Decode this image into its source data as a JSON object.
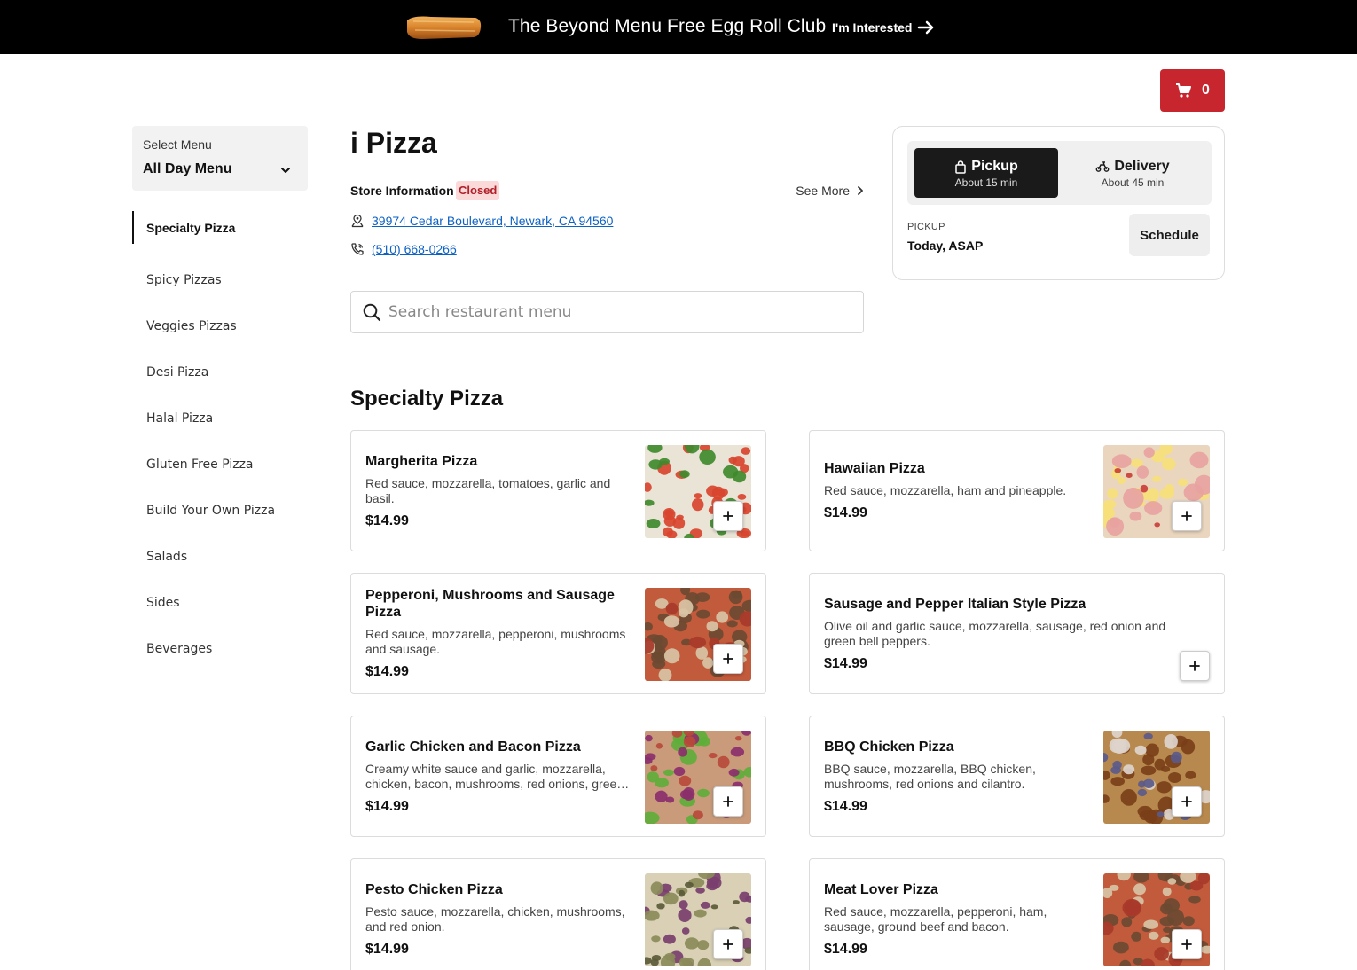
{
  "banner": {
    "title": "The Beyond Menu Free Egg Roll Club",
    "cta_label": "I'm Interested"
  },
  "cart": {
    "count": "0"
  },
  "menu_select": {
    "label": "Select Menu",
    "value": "All Day Menu"
  },
  "sidebar": {
    "items": [
      {
        "label": "Specialty Pizza",
        "active": true
      },
      {
        "label": "Spicy Pizzas"
      },
      {
        "label": "Veggies Pizzas"
      },
      {
        "label": "Desi Pizza"
      },
      {
        "label": "Halal Pizza"
      },
      {
        "label": "Gluten Free Pizza"
      },
      {
        "label": "Build Your Own Pizza"
      },
      {
        "label": "Salads"
      },
      {
        "label": "Sides"
      },
      {
        "label": "Beverages"
      }
    ]
  },
  "store": {
    "name": "i Pizza",
    "info_label": "Store Information",
    "status": "Closed",
    "see_more": "See More",
    "address": "39974 Cedar Boulevard, Newark, CA 94560",
    "phone": "(510) 668-0266"
  },
  "search": {
    "placeholder": "Search restaurant menu"
  },
  "order": {
    "pickup": {
      "label": "Pickup",
      "time": "About 15 min"
    },
    "delivery": {
      "label": "Delivery",
      "time": "About 45 min"
    },
    "mode_caption": "PICKUP",
    "when": "Today, ASAP",
    "schedule_label": "Schedule"
  },
  "section": {
    "title": "Specialty Pizza",
    "items": [
      {
        "name": "Margherita Pizza",
        "desc": "Red sauce, mozzarella, tomatoes, garlic and basil.",
        "price": "$14.99",
        "image": "margherita"
      },
      {
        "name": "Hawaiian Pizza",
        "desc": "Red sauce, mozzarella, ham and pineapple.",
        "price": "$14.99",
        "image": "hawaiian"
      },
      {
        "name": "Pepperoni, Mushrooms and Sausage Pizza",
        "desc": "Red sauce, mozzarella, pepperoni, mushrooms and sausage.",
        "price": "$14.99",
        "image": "meat"
      },
      {
        "name": "Sausage and Pepper Italian Style Pizza",
        "desc": "Olive oil and garlic sauce, mozzarella, sausage, red onion and green bell peppers.",
        "price": "$14.99",
        "image": null
      },
      {
        "name": "Garlic Chicken and Bacon Pizza",
        "desc": "Creamy white sauce and garlic, mozzarella, chicken, bacon, mushrooms, red onions, green peppers.",
        "price": "$14.99",
        "image": "veggie"
      },
      {
        "name": "BBQ Chicken Pizza",
        "desc": "BBQ sauce, mozzarella, BBQ chicken, mushrooms, red onions and cilantro.",
        "price": "$14.99",
        "image": "bbq"
      },
      {
        "name": "Pesto Chicken Pizza",
        "desc": "Pesto sauce, mozzarella, chicken, mushrooms, and red onion.",
        "price": "$14.99",
        "image": "pesto"
      },
      {
        "name": "Meat Lover Pizza",
        "desc": "Red sauce, mozzarella, pepperoni, ham, sausage, ground beef and bacon.",
        "price": "$14.99",
        "image": "meat"
      }
    ]
  },
  "icons": {
    "arrow": "arrow-right-icon",
    "cart": "shopping-cart-icon",
    "chevron": "chevron-down-icon",
    "location": "location-icon",
    "phone": "phone-icon",
    "search": "search-icon",
    "bag": "bag-icon",
    "scooter": "scooter-icon",
    "add": "plus-icon"
  },
  "colors": {
    "brand_red": "#c8262e",
    "link": "#0d62c4",
    "closed_bg": "#fbd9d9",
    "closed_text": "#b0202a"
  }
}
